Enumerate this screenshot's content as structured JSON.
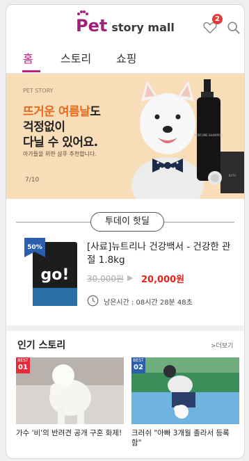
{
  "header": {
    "logo_pet": "Pet",
    "logo_rest": "story mall",
    "cart_count": "2",
    "paw": "❚❚❚"
  },
  "tabs": [
    {
      "label": "홈",
      "active": true
    },
    {
      "label": "스토리",
      "active": false
    },
    {
      "label": "쇼핑",
      "active": false
    }
  ],
  "banner": {
    "kicker": "PET STORY",
    "headline_accent": "뜨거운 여름날",
    "headline_rest": "도",
    "line2": "걱정없이",
    "line3": "다닐 수 있어요.",
    "sub": "아가들을 위한 샴푸 추천합니다.",
    "page": "7/10",
    "bottle_label": "PERFUME SHAMPOO",
    "jar_label": "BATH"
  },
  "deal": {
    "section_label": "투데이 핫딜",
    "discount": "50%",
    "brand_mark": "go!",
    "title": "[사료]뉴트리나 건강백서 - 건강한 관절 1.8kg",
    "original_price": "30,000원",
    "arrow": "▶",
    "sale_price": "20,000원",
    "time_left": "남은시간 : 08시간 28분 48초"
  },
  "popular": {
    "title": "인기 스토리",
    "more": ">더보기",
    "cards": [
      {
        "best": "BEST",
        "rank": "01",
        "caption": "가수 '비'의 반려견 공개 구혼 화제!"
      },
      {
        "best": "BEST",
        "rank": "02",
        "caption": "크러쉬 \"아빠 3개월 졸라서 등록함\""
      }
    ]
  },
  "colors": {
    "brand": "#a0207a",
    "tab_active": "#c02080",
    "banner_bg": "#f8ddb9",
    "accent_orange": "#e86a1f",
    "sale_red": "#e4241c"
  }
}
